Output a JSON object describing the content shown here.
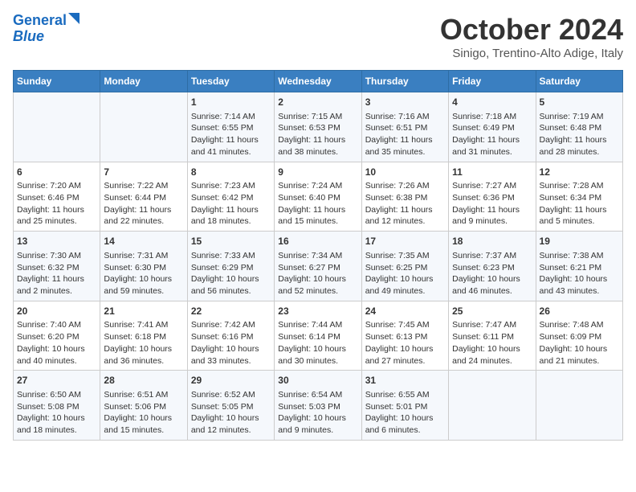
{
  "header": {
    "logo_line1": "General",
    "logo_line2": "Blue",
    "title": "October 2024",
    "subtitle": "Sinigo, Trentino-Alto Adige, Italy"
  },
  "days_of_week": [
    "Sunday",
    "Monday",
    "Tuesday",
    "Wednesday",
    "Thursday",
    "Friday",
    "Saturday"
  ],
  "weeks": [
    [
      {
        "day": "",
        "content": ""
      },
      {
        "day": "",
        "content": ""
      },
      {
        "day": "1",
        "content": "Sunrise: 7:14 AM\nSunset: 6:55 PM\nDaylight: 11 hours and 41 minutes."
      },
      {
        "day": "2",
        "content": "Sunrise: 7:15 AM\nSunset: 6:53 PM\nDaylight: 11 hours and 38 minutes."
      },
      {
        "day": "3",
        "content": "Sunrise: 7:16 AM\nSunset: 6:51 PM\nDaylight: 11 hours and 35 minutes."
      },
      {
        "day": "4",
        "content": "Sunrise: 7:18 AM\nSunset: 6:49 PM\nDaylight: 11 hours and 31 minutes."
      },
      {
        "day": "5",
        "content": "Sunrise: 7:19 AM\nSunset: 6:48 PM\nDaylight: 11 hours and 28 minutes."
      }
    ],
    [
      {
        "day": "6",
        "content": "Sunrise: 7:20 AM\nSunset: 6:46 PM\nDaylight: 11 hours and 25 minutes."
      },
      {
        "day": "7",
        "content": "Sunrise: 7:22 AM\nSunset: 6:44 PM\nDaylight: 11 hours and 22 minutes."
      },
      {
        "day": "8",
        "content": "Sunrise: 7:23 AM\nSunset: 6:42 PM\nDaylight: 11 hours and 18 minutes."
      },
      {
        "day": "9",
        "content": "Sunrise: 7:24 AM\nSunset: 6:40 PM\nDaylight: 11 hours and 15 minutes."
      },
      {
        "day": "10",
        "content": "Sunrise: 7:26 AM\nSunset: 6:38 PM\nDaylight: 11 hours and 12 minutes."
      },
      {
        "day": "11",
        "content": "Sunrise: 7:27 AM\nSunset: 6:36 PM\nDaylight: 11 hours and 9 minutes."
      },
      {
        "day": "12",
        "content": "Sunrise: 7:28 AM\nSunset: 6:34 PM\nDaylight: 11 hours and 5 minutes."
      }
    ],
    [
      {
        "day": "13",
        "content": "Sunrise: 7:30 AM\nSunset: 6:32 PM\nDaylight: 11 hours and 2 minutes."
      },
      {
        "day": "14",
        "content": "Sunrise: 7:31 AM\nSunset: 6:30 PM\nDaylight: 10 hours and 59 minutes."
      },
      {
        "day": "15",
        "content": "Sunrise: 7:33 AM\nSunset: 6:29 PM\nDaylight: 10 hours and 56 minutes."
      },
      {
        "day": "16",
        "content": "Sunrise: 7:34 AM\nSunset: 6:27 PM\nDaylight: 10 hours and 52 minutes."
      },
      {
        "day": "17",
        "content": "Sunrise: 7:35 AM\nSunset: 6:25 PM\nDaylight: 10 hours and 49 minutes."
      },
      {
        "day": "18",
        "content": "Sunrise: 7:37 AM\nSunset: 6:23 PM\nDaylight: 10 hours and 46 minutes."
      },
      {
        "day": "19",
        "content": "Sunrise: 7:38 AM\nSunset: 6:21 PM\nDaylight: 10 hours and 43 minutes."
      }
    ],
    [
      {
        "day": "20",
        "content": "Sunrise: 7:40 AM\nSunset: 6:20 PM\nDaylight: 10 hours and 40 minutes."
      },
      {
        "day": "21",
        "content": "Sunrise: 7:41 AM\nSunset: 6:18 PM\nDaylight: 10 hours and 36 minutes."
      },
      {
        "day": "22",
        "content": "Sunrise: 7:42 AM\nSunset: 6:16 PM\nDaylight: 10 hours and 33 minutes."
      },
      {
        "day": "23",
        "content": "Sunrise: 7:44 AM\nSunset: 6:14 PM\nDaylight: 10 hours and 30 minutes."
      },
      {
        "day": "24",
        "content": "Sunrise: 7:45 AM\nSunset: 6:13 PM\nDaylight: 10 hours and 27 minutes."
      },
      {
        "day": "25",
        "content": "Sunrise: 7:47 AM\nSunset: 6:11 PM\nDaylight: 10 hours and 24 minutes."
      },
      {
        "day": "26",
        "content": "Sunrise: 7:48 AM\nSunset: 6:09 PM\nDaylight: 10 hours and 21 minutes."
      }
    ],
    [
      {
        "day": "27",
        "content": "Sunrise: 6:50 AM\nSunset: 5:08 PM\nDaylight: 10 hours and 18 minutes."
      },
      {
        "day": "28",
        "content": "Sunrise: 6:51 AM\nSunset: 5:06 PM\nDaylight: 10 hours and 15 minutes."
      },
      {
        "day": "29",
        "content": "Sunrise: 6:52 AM\nSunset: 5:05 PM\nDaylight: 10 hours and 12 minutes."
      },
      {
        "day": "30",
        "content": "Sunrise: 6:54 AM\nSunset: 5:03 PM\nDaylight: 10 hours and 9 minutes."
      },
      {
        "day": "31",
        "content": "Sunrise: 6:55 AM\nSunset: 5:01 PM\nDaylight: 10 hours and 6 minutes."
      },
      {
        "day": "",
        "content": ""
      },
      {
        "day": "",
        "content": ""
      }
    ]
  ]
}
